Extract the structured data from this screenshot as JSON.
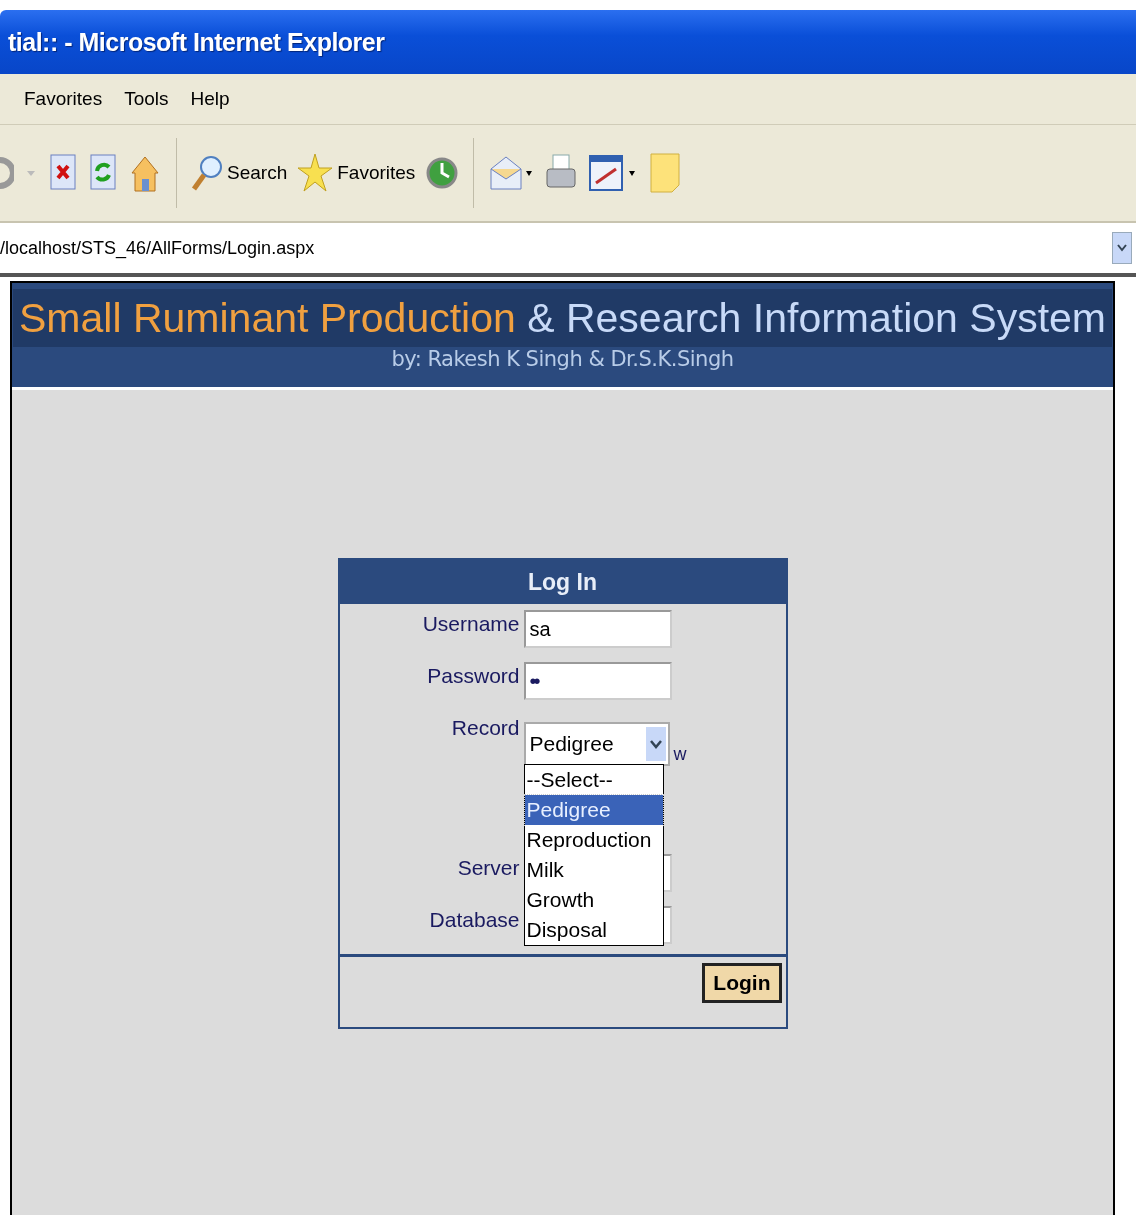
{
  "window": {
    "title": "tial:: - Microsoft Internet Explorer"
  },
  "menu": [
    "Favorites",
    "Tools",
    "Help"
  ],
  "toolbar": {
    "search_label": "Search",
    "favorites_label": "Favorites"
  },
  "address": {
    "value": "/localhost/STS_46/AllForms/Login.aspx"
  },
  "header": {
    "title_highlight": "Small Ruminant Production",
    "title_rest": "& Research Information System",
    "subtitle": "by: Rakesh K Singh & Dr.S.K.Singh"
  },
  "login": {
    "heading": "Log In",
    "fields": [
      {
        "label": "Username",
        "value": "sa"
      },
      {
        "label": "Password",
        "value": "••"
      }
    ],
    "record": {
      "label": "Record",
      "value": "Pedigree",
      "expanded": true,
      "options": [
        {
          "label": "--Select--",
          "selected": false
        },
        {
          "label": "Pedigree",
          "selected": true
        },
        {
          "label": "Reproduction",
          "selected": false
        },
        {
          "label": "Milk",
          "selected": false
        },
        {
          "label": "Growth",
          "selected": false
        },
        {
          "label": "Disposal",
          "selected": false
        }
      ]
    },
    "hidden_fragment": "w",
    "server_label": "Server",
    "database_label": "Database",
    "button": "Login"
  }
}
